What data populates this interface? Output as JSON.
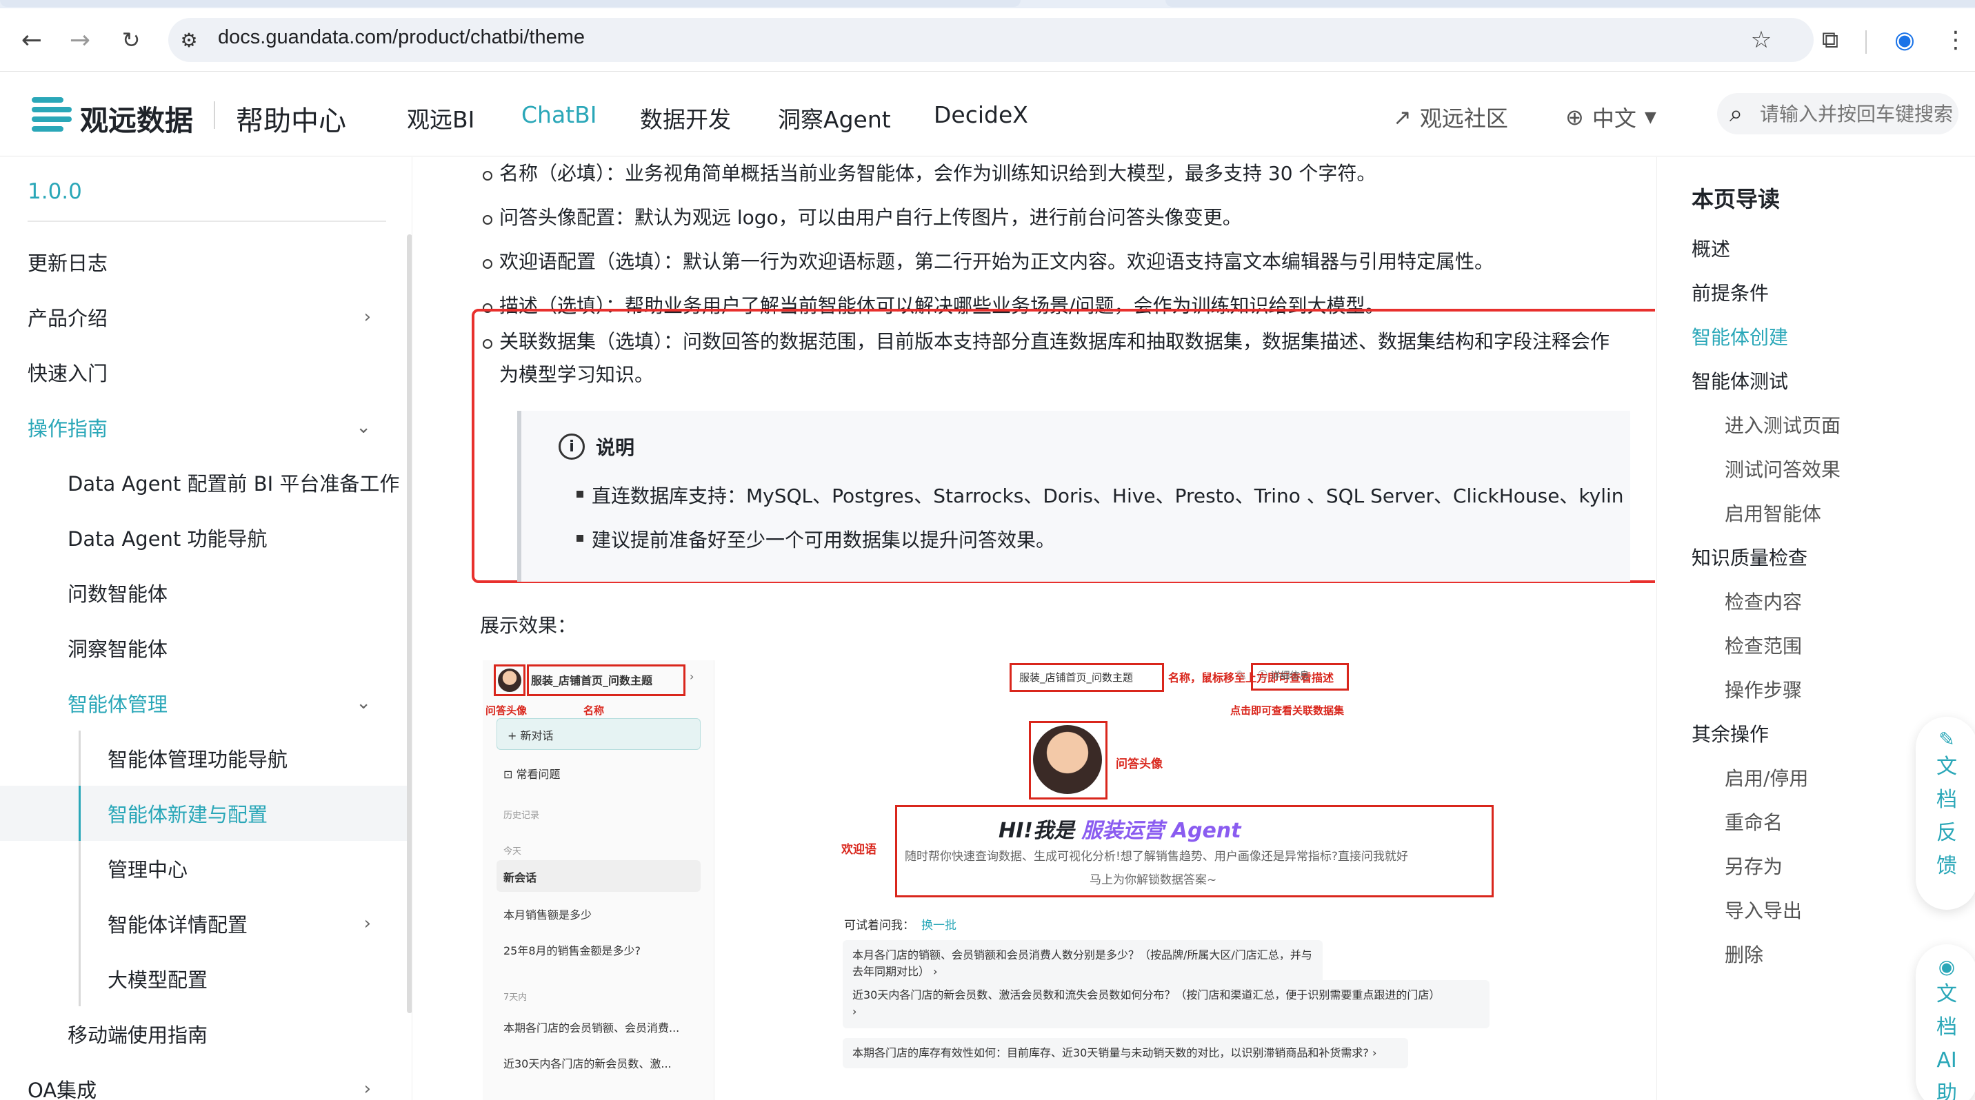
{
  "browser": {
    "url": "docs.guandata.com/product/chatbi/theme"
  },
  "header": {
    "brand": "观远数据",
    "help_center": "帮助中心",
    "nav": [
      "观远BI",
      "ChatBI",
      "数据开发",
      "洞察Agent",
      "DecideX"
    ],
    "active_nav": "ChatBI",
    "community": "观远社区",
    "language": "中文",
    "search_placeholder": "请输入并按回车键搜索"
  },
  "sidebar": {
    "version": "1.0.0",
    "items": [
      {
        "label": "更新日志"
      },
      {
        "label": "产品介绍"
      },
      {
        "label": "快速入门"
      },
      {
        "label": "操作指南"
      },
      {
        "label": "Data Agent 配置前 BI 平台准备工作"
      },
      {
        "label": "Data Agent 功能导航"
      },
      {
        "label": "问数智能体"
      },
      {
        "label": "洞察智能体"
      },
      {
        "label": "智能体管理"
      },
      {
        "label": "智能体管理功能导航"
      },
      {
        "label": "智能体新建与配置"
      },
      {
        "label": "管理中心"
      },
      {
        "label": "智能体详情配置"
      },
      {
        "label": "大模型配置"
      },
      {
        "label": "移动端使用指南"
      },
      {
        "label": "OA集成"
      }
    ]
  },
  "content": {
    "bullets": [
      "名称（必填）：业务视角简单概括当前业务智能体，会作为训练知识给到大模型，最多支持 30 个字符。",
      "问答头像配置：默认为观远 logo，可以由用户自行上传图片，进行前台问答头像变更。",
      "欢迎语配置（选填）：默认第一行为欢迎语标题，第二行开始为正文内容。欢迎语支持富文本编辑器与引用特定属性。",
      "描述（选填）：帮助业务用户了解当前智能体可以解决哪些业务场景/问题，会作为训练知识给到大模型。",
      "关联数据集（选填）：问数回答的数据范围，目前版本支持部分直连数据库和抽取数据集，数据集描述、数据集结构和字段注释会作",
      "为模型学习知识。"
    ],
    "note_title": "说明",
    "note_items": [
      "直连数据库支持：MySQL、Postgres、Starrocks、Doris、Hive、Presto、Trino 、SQL Server、ClickHouse、kylin",
      "建议提前准备好至少一个可用数据集以提升问答效果。"
    ],
    "display_label": "展示效果："
  },
  "screenshot": {
    "sidebar_title": "服装_店铺首页_问数主题",
    "new_chat": "新对话",
    "faq": "常看问题",
    "history": "历史记录",
    "today": "今天",
    "selected_chat": "新会话",
    "chat_1": "本月销售额是多少",
    "chat_2": "25年8月的销售金额是多少?",
    "seven_days": "7天内",
    "chat_3": "本期各门店的会员销额、会员消费...",
    "chat_4": "近30天内各门店的新会员数、激...",
    "label_avatar": "问答头像",
    "label_name": "名称",
    "main_title": "服装_店铺首页_问数主题",
    "label_name_hover": "名称，鼠标移至上方即可查看描述",
    "detail_btn": "详细信息",
    "label_detail": "点击即可查看关联数据集",
    "label_avatar_2": "问答头像",
    "hi_prefix": "HI!我是 ",
    "hi_agent": "服装运营 Agent",
    "label_welcome": "欢迎语",
    "welcome_line1": "随时帮你快速查询数据、生成可视化分析!想了解销售趋势、用户画像还是异常指标?直接问我就好",
    "welcome_line2": "马上为你解锁数据答案~",
    "try_ask": "可试着问我：",
    "refresh": "换一批",
    "q1": "本月各门店的销额、会员销额和会员消费人数分别是多少？（按品牌/所属大区/门店汇总，并与去年同期对比）  ›",
    "q2": "近30天内各门店的新会员数、激活会员数和流失会员数如何分布？（按门店和渠道汇总，便于识别需要重点跟进的门店）",
    "q2_arrow": "›",
    "q3": "本期各门店的库存有效性如何：目前库存、近30天销量与未动销天数的对比，以识别滞销商品和补货需求?  ›"
  },
  "toc": {
    "title": "本页导读",
    "items": [
      {
        "label": "概述",
        "level": 1
      },
      {
        "label": "前提条件",
        "level": 1
      },
      {
        "label": "智能体创建",
        "level": 1,
        "active": true
      },
      {
        "label": "智能体测试",
        "level": 1
      },
      {
        "label": "进入测试页面",
        "level": 2
      },
      {
        "label": "测试问答效果",
        "level": 2
      },
      {
        "label": "启用智能体",
        "level": 2
      },
      {
        "label": "知识质量检查",
        "level": 1
      },
      {
        "label": "检查内容",
        "level": 2
      },
      {
        "label": "检查范围",
        "level": 2
      },
      {
        "label": "操作步骤",
        "level": 2
      },
      {
        "label": "其余操作",
        "level": 1
      },
      {
        "label": "启用/停用",
        "level": 2
      },
      {
        "label": "重命名",
        "level": 2
      },
      {
        "label": "另存为",
        "level": 2
      },
      {
        "label": "导入导出",
        "level": 2
      },
      {
        "label": "删除",
        "level": 2
      }
    ]
  },
  "floating": {
    "feedback": "文档反馈",
    "ai": "文档AI助"
  },
  "colors": {
    "accent": "#2aa7b8",
    "highlight_red": "#e8302d"
  }
}
